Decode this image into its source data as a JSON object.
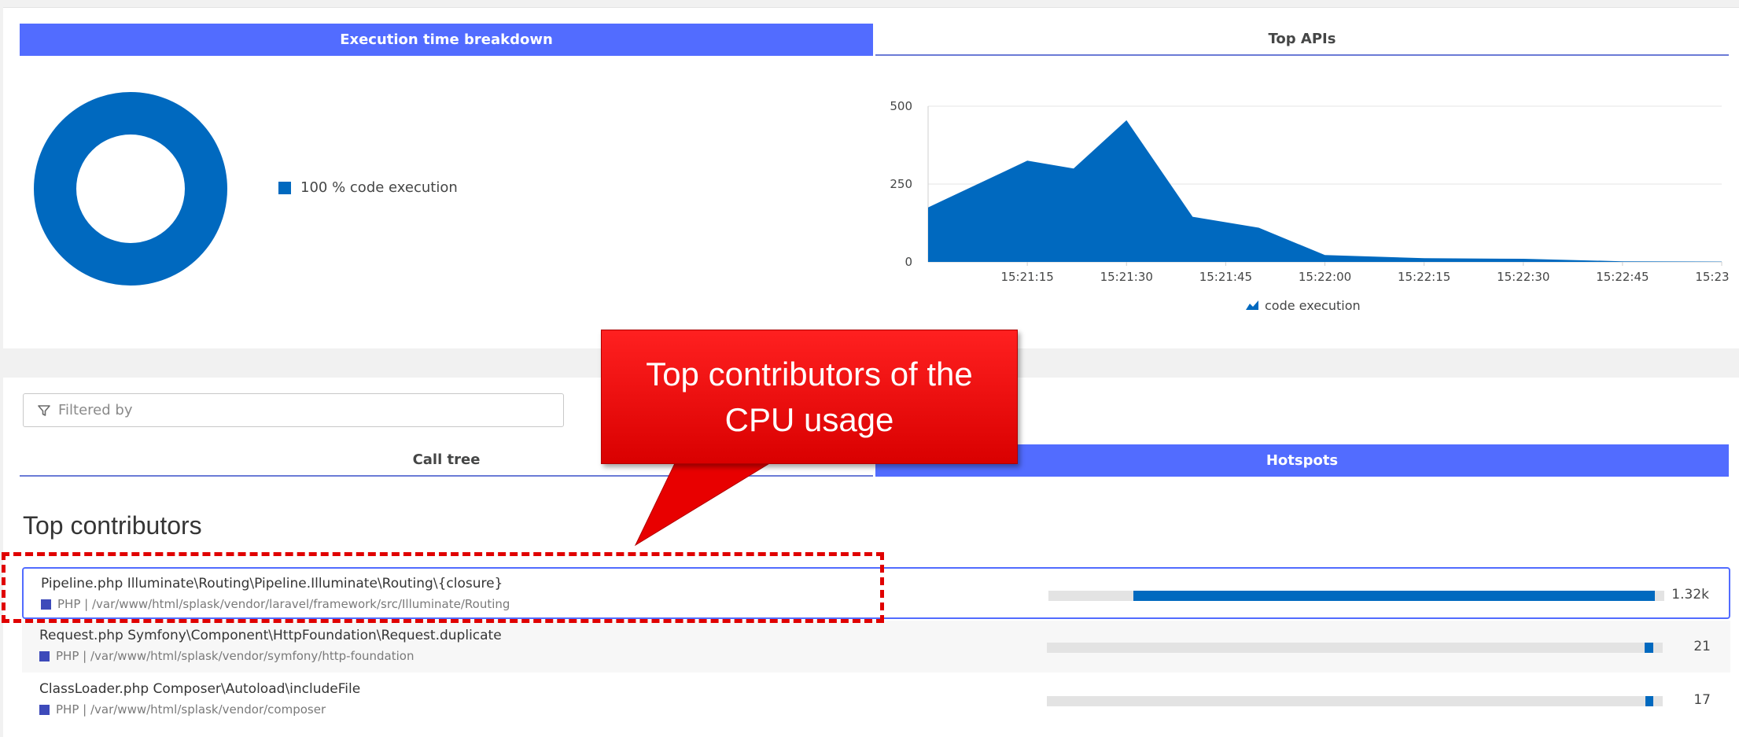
{
  "top_tabs": {
    "execution": "Execution time breakdown",
    "top_apis": "Top APIs"
  },
  "donut_legend": "100 % code execution",
  "chart_data": [
    {
      "type": "pie",
      "title": "",
      "categories": [
        "code execution"
      ],
      "values": [
        100
      ],
      "colors": [
        "#0069bf"
      ]
    },
    {
      "type": "area",
      "title": "",
      "x": [
        "15:21:00",
        "15:21:15",
        "15:21:22",
        "15:21:30",
        "15:21:40",
        "15:21:50",
        "15:22:00",
        "15:22:15",
        "15:22:30",
        "15:22:45",
        "15:23:00"
      ],
      "series": [
        {
          "name": "code execution",
          "values": [
            175,
            325,
            300,
            455,
            145,
            110,
            22,
            12,
            10,
            2,
            1
          ]
        }
      ],
      "y_ticks": [
        "0",
        "250",
        "500"
      ],
      "x_ticks": [
        "15:21:15",
        "15:21:30",
        "15:21:45",
        "15:22:00",
        "15:22:15",
        "15:22:30",
        "15:22:45",
        "15:23:00"
      ],
      "ylim": [
        0,
        500
      ],
      "grid": true,
      "legend": "bottom",
      "color": "#0069bf"
    }
  ],
  "area_legend": "code execution",
  "filter": {
    "placeholder": "Filtered by"
  },
  "bottom_tabs": {
    "call_tree": "Call tree",
    "hotspots": "Hotspots"
  },
  "section_title": "Top contributors",
  "contributors": [
    {
      "title": "Pipeline.php Illuminate\\Routing\\Pipeline.Illuminate\\Routing\\{closure}",
      "sub": "PHP | /var/www/html/splask/vendor/laravel/framework/src/Illuminate/Routing",
      "value": "1.32k",
      "fraction": 0.86
    },
    {
      "title": "Request.php Symfony\\Component\\HttpFoundation\\Request.duplicate",
      "sub": "PHP | /var/www/html/splask/vendor/symfony/http-foundation",
      "value": "21",
      "fraction": 0.014
    },
    {
      "title": "ClassLoader.php Composer\\Autoload\\includeFile",
      "sub": "PHP | /var/www/html/splask/vendor/composer",
      "value": "17",
      "fraction": 0.011
    }
  ],
  "callout": "Top contributors of the CPU usage",
  "colors": {
    "accent": "#526cff",
    "series": "#0069bf",
    "callout": "#e00000"
  }
}
